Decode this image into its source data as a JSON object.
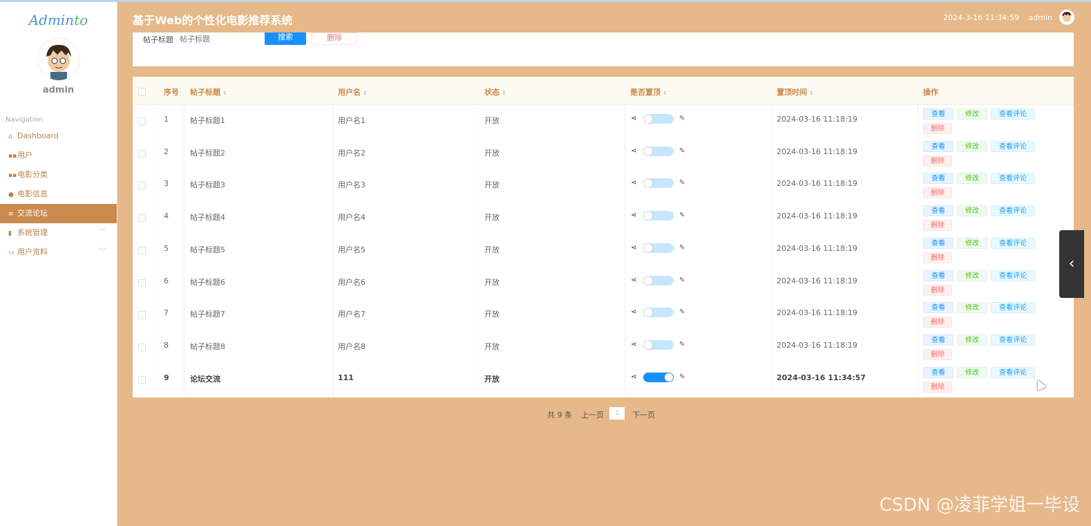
{
  "brand": {
    "logo_main": "Admin",
    "logo_accent": "to"
  },
  "sidebar": {
    "username": "admin",
    "nav_title": "Navigation",
    "items": [
      {
        "label": "Dashboard",
        "icon": "home-icon"
      },
      {
        "label": "用户",
        "icon": "grid-icon"
      },
      {
        "label": "电影分类",
        "icon": "grid-icon"
      },
      {
        "label": "电影信息",
        "icon": "person-icon"
      },
      {
        "label": "交流论坛",
        "icon": "list-icon",
        "active": true
      },
      {
        "label": "系统管理",
        "icon": "bars-icon",
        "expandable": true
      },
      {
        "label": "用户资料",
        "icon": "card-icon",
        "expandable": true
      }
    ]
  },
  "header": {
    "title": "基于Web的个性化电影推荐系统",
    "datetime": "2024-3-16 11:34:59",
    "user": "admin"
  },
  "search": {
    "label": "帖子标题",
    "placeholder": "帖子标题",
    "search_btn": "搜索",
    "delete_btn": "删除"
  },
  "table": {
    "columns": [
      "序号",
      "帖子标题",
      "用户名",
      "状态",
      "是否置顶",
      "置顶时间",
      "操作"
    ],
    "actions": {
      "view": "查看",
      "edit": "修改",
      "comments": "查看评论",
      "delete": "删除"
    },
    "rows": [
      {
        "no": "1",
        "title": "帖子标题1",
        "user": "用户名1",
        "status": "开放",
        "pinned": false,
        "time": "2024-03-16 11:18:19"
      },
      {
        "no": "2",
        "title": "帖子标题2",
        "user": "用户名2",
        "status": "开放",
        "pinned": false,
        "time": "2024-03-16 11:18:19"
      },
      {
        "no": "3",
        "title": "帖子标题3",
        "user": "用户名3",
        "status": "开放",
        "pinned": false,
        "time": "2024-03-16 11:18:19"
      },
      {
        "no": "4",
        "title": "帖子标题4",
        "user": "用户名4",
        "status": "开放",
        "pinned": false,
        "time": "2024-03-16 11:18:19"
      },
      {
        "no": "5",
        "title": "帖子标题5",
        "user": "用户名5",
        "status": "开放",
        "pinned": false,
        "time": "2024-03-16 11:18:19"
      },
      {
        "no": "6",
        "title": "帖子标题6",
        "user": "用户名6",
        "status": "开放",
        "pinned": false,
        "time": "2024-03-16 11:18:19"
      },
      {
        "no": "7",
        "title": "帖子标题7",
        "user": "用户名7",
        "status": "开放",
        "pinned": false,
        "time": "2024-03-16 11:18:19"
      },
      {
        "no": "8",
        "title": "帖子标题8",
        "user": "用户名8",
        "status": "开放",
        "pinned": false,
        "time": "2024-03-16 11:18:19"
      },
      {
        "no": "9",
        "title": "论坛交流",
        "user": "111",
        "status": "开放",
        "pinned": true,
        "time": "2024-03-16 11:34:57"
      }
    ]
  },
  "pager": {
    "total": "共 9 条",
    "prev": "上一页",
    "page": "1",
    "next": "下一页"
  },
  "watermark": "CSDN @凌菲学姐一毕设",
  "colors": {
    "header_bg": "#e6b88a",
    "active_nav": "#c98a4d",
    "primary": "#1890ff"
  }
}
